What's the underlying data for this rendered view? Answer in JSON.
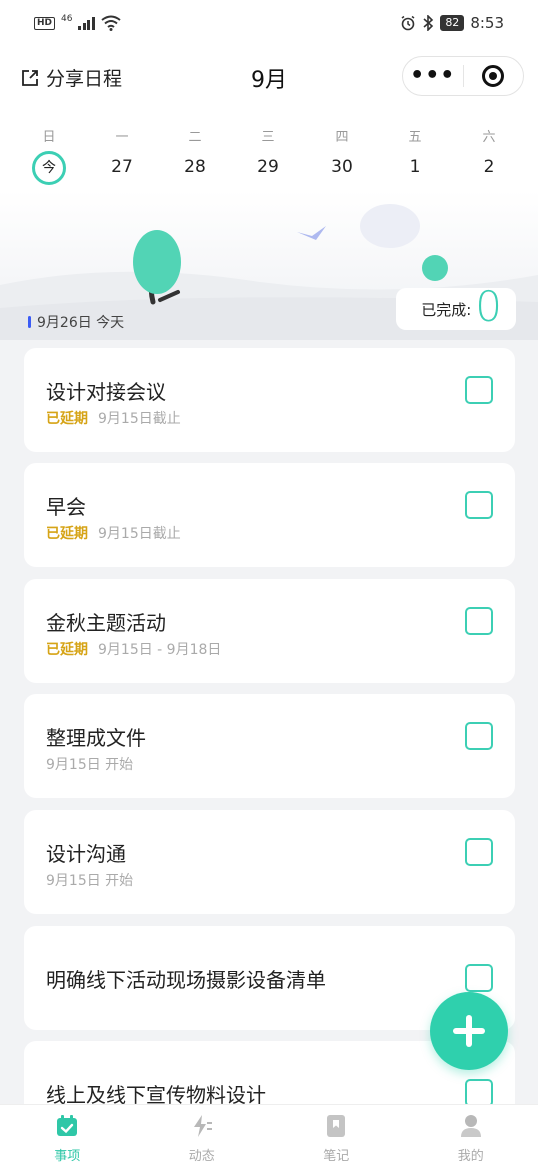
{
  "status_bar": {
    "hd": "HD",
    "network": "46",
    "battery": "82",
    "time": "8:53"
  },
  "header": {
    "share_label": "分享日程",
    "month_title": "9月",
    "more_icon": "more-dots-icon",
    "target_icon": "target-icon"
  },
  "week": [
    {
      "day": "日",
      "date": "今",
      "today": true
    },
    {
      "day": "一",
      "date": "27"
    },
    {
      "day": "二",
      "date": "28"
    },
    {
      "day": "三",
      "date": "29"
    },
    {
      "day": "四",
      "date": "30"
    },
    {
      "day": "五",
      "date": "1"
    },
    {
      "day": "六",
      "date": "2"
    }
  ],
  "summary": {
    "date_label": "9月26日 今天",
    "done_label": "已完成:",
    "done_count": "0"
  },
  "tasks": [
    {
      "title": "设计对接会议",
      "tag": "已延期",
      "meta": "9月15日截止"
    },
    {
      "title": "早会",
      "tag": "已延期",
      "meta": "9月15日截止"
    },
    {
      "title": "金秋主题活动",
      "tag": "已延期",
      "meta": "9月15日 - 9月18日"
    },
    {
      "title": "整理成文件",
      "tag": "",
      "meta": "9月15日 开始"
    },
    {
      "title": "设计沟通",
      "tag": "",
      "meta": "9月15日 开始"
    },
    {
      "title": "明确线下活动现场摄影设备清单",
      "tag": "",
      "meta": ""
    },
    {
      "title": "线上及线下宣传物料设计",
      "tag": "",
      "meta": ""
    }
  ],
  "fab_icon": "plus-icon",
  "nav": [
    {
      "label": "事项",
      "icon": "calendar-check-icon",
      "active": true
    },
    {
      "label": "动态",
      "icon": "lightning-icon",
      "active": false
    },
    {
      "label": "笔记",
      "icon": "bookmark-icon",
      "active": false
    },
    {
      "label": "我的",
      "icon": "user-icon",
      "active": false
    }
  ],
  "colors": {
    "accent": "#3ccfb4",
    "delay": "#d6a417",
    "date_bar": "#3b5cf5"
  }
}
